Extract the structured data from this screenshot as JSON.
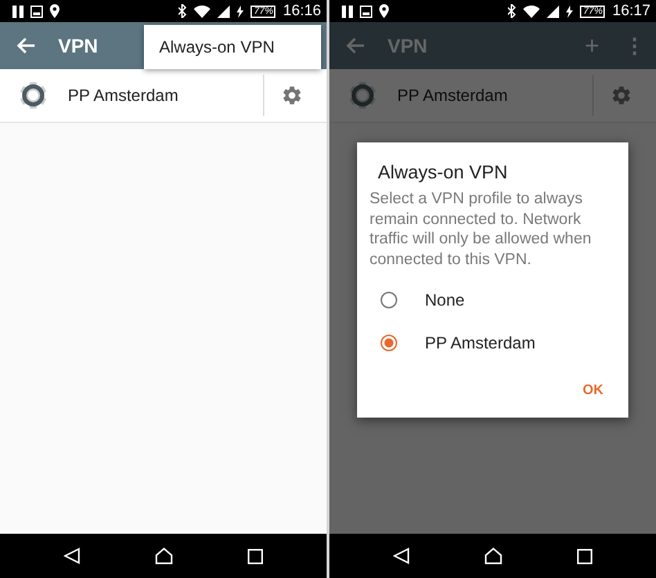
{
  "screens": [
    {
      "status_bar": {
        "battery": "77%",
        "time": "16:16"
      },
      "toolbar": {
        "title": "VPN"
      },
      "vpn_profiles": [
        {
          "name": "PP Amsterdam"
        }
      ],
      "overflow_menu": {
        "items": [
          {
            "label": "Always-on VPN"
          }
        ]
      }
    },
    {
      "status_bar": {
        "battery": "77%",
        "time": "16:17"
      },
      "toolbar": {
        "title": "VPN",
        "actions": [
          {
            "kind": "add",
            "label": "+"
          },
          {
            "kind": "more",
            "label": "⋮"
          }
        ]
      },
      "vpn_profiles": [
        {
          "name": "PP Amsterdam"
        }
      ],
      "dialog": {
        "title": "Always-on VPN",
        "message": "Select a VPN profile to always remain connected to. Network traffic will only be allowed when connected to this VPN.",
        "options": [
          {
            "label": "None",
            "selected": false
          },
          {
            "label": "PP Amsterdam",
            "selected": true
          }
        ],
        "buttons": [
          "OK"
        ]
      }
    }
  ]
}
